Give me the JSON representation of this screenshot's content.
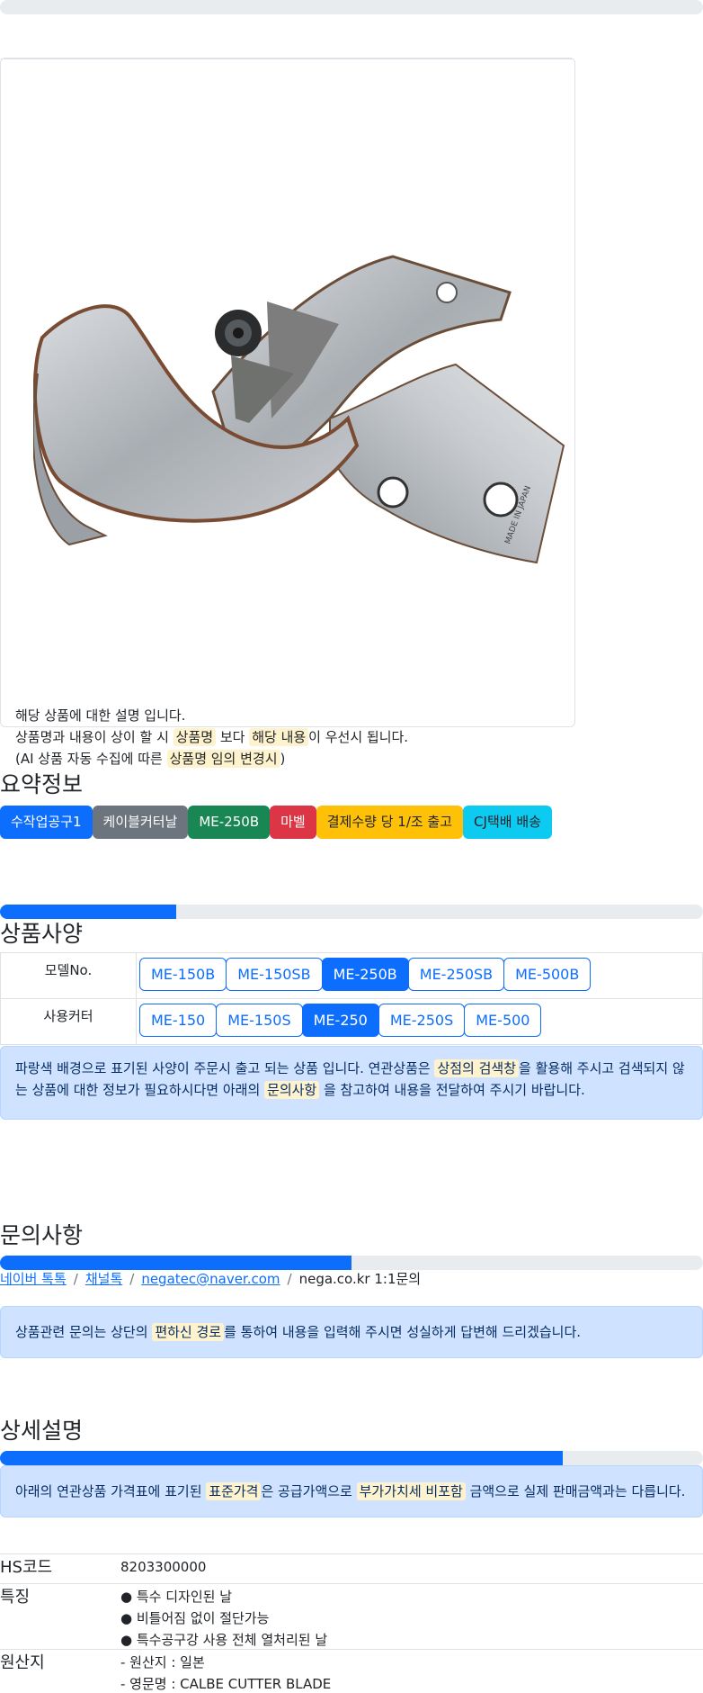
{
  "progress": {
    "top_bar": 0,
    "spec_bar": 0.25,
    "inquiry_bar": 0.5,
    "detail_bar": 0.8
  },
  "product_image": {
    "alt": "MADE IN JAPAN",
    "engraving": "MADE IN JAPAN"
  },
  "notice": {
    "line1": "해당 상품에 대한 설명 입니다.",
    "line2_a": "상품명과 내용이 상이 할 시 ",
    "line2_hl1": "상품명",
    "line2_b": " 보다 ",
    "line2_hl2": "해당 내용",
    "line2_c": "이 우선시 됩니다.",
    "line3_a": "(AI 상품 자동 수집에 따른 ",
    "line3_hl": "상품명 임의 변경시",
    "line3_b": ")"
  },
  "summary": {
    "title": "요약정보",
    "badges": [
      {
        "label": "수작업공구1",
        "color": "#0d6efd",
        "text": "#ffffff"
      },
      {
        "label": "케이블커터날",
        "color": "#6c757d",
        "text": "#ffffff"
      },
      {
        "label": "ME-250B",
        "color": "#198754",
        "text": "#ffffff"
      },
      {
        "label": "마벨",
        "color": "#dc3545",
        "text": "#ffffff"
      },
      {
        "label": "결제수량 당 1/조 출고",
        "color": "#ffc107",
        "text": "#212529"
      },
      {
        "label": "CJ택배 배송",
        "color": "#0dcaf0",
        "text": "#212529"
      }
    ]
  },
  "spec": {
    "title": "상품사양",
    "rows": [
      {
        "label": "모델No.",
        "options": [
          "ME-150B",
          "ME-150SB",
          "ME-250B",
          "ME-250SB",
          "ME-500B"
        ],
        "active": 2
      },
      {
        "label": "사용커터",
        "options": [
          "ME-150",
          "ME-150S",
          "ME-250",
          "ME-250S",
          "ME-500"
        ],
        "active": 2
      }
    ],
    "alert_a": "파랑색 배경으로 표기된 사양이 주문시 출고 되는 상품 입니다. 연관상품은 ",
    "alert_hl1": "상점의 검색창",
    "alert_b": "을 활용해 주시고 검색되지 않는 상품에 대한 정보가 필요하시다면 아래의 ",
    "alert_hl2": "문의사항",
    "alert_c": " 을 참고하여 내용을 전달하여 주시기 바랍니다."
  },
  "inquiry": {
    "title": "문의사항",
    "link1": "네이버 톡톡",
    "link2": "채널톡",
    "link3": "negatec@naver.com",
    "text4": "nega.co.kr 1:1문의",
    "alert_a": "상품관련 문의는 상단의 ",
    "alert_hl": "편하신 경로",
    "alert_b": "를 통하여 내용을 입력해 주시면 성실하게 답변해 드리겠습니다."
  },
  "detail": {
    "title": "상세설명",
    "alert_a": "아래의 연관상품 가격표에 표기된 ",
    "alert_hl1": "표준가격",
    "alert_b": "은 공급가액으로 ",
    "alert_hl2": "부가가치세 비포함",
    "alert_c": " 금액으로 실제 판매금액과는 다릅니다.",
    "hs_label": "HS코드",
    "hs_value": "8203300000",
    "feature_label": "특징",
    "features": [
      "● 특수 디자인된 날",
      "● 비틀어짐 없이 절단가능",
      "● 특수공구강 사용 전체 열처리된 날"
    ],
    "origin_label": "원산지",
    "origin": [
      "- 원산지 : 일본",
      "- 영문명 : CALBE CUTTER BLADE"
    ]
  }
}
